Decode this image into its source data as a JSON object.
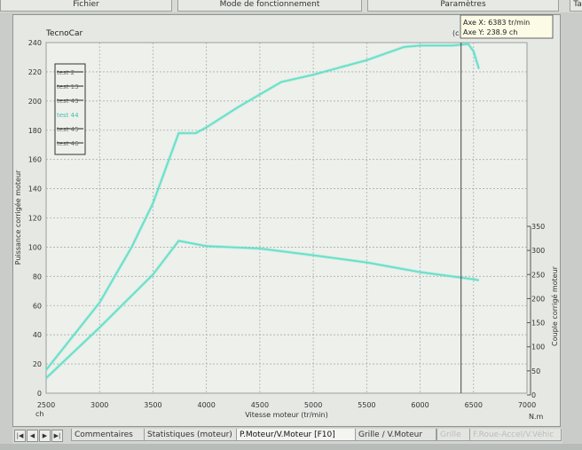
{
  "menu": {
    "fichier": "Fichier",
    "mode": "Mode de fonctionnement",
    "parametres": "Paramètres",
    "side": "Ta"
  },
  "chart": {
    "brand": "TecnoCar",
    "marker": "(c",
    "cursor_x": "Axe X: 6383 tr/min",
    "cursor_y": "Axe Y: 238.9 ch",
    "left_ylabel": "Puissance corrigée moteur",
    "right_ylabel": "Couple corrigé moteur",
    "xlabel": "Vitesse moteur (tr/min)",
    "left_unit": "ch",
    "right_unit": "N.m",
    "legend": [
      "test 2",
      "test 13",
      "test 43",
      "test 44",
      "test 45",
      "test 46"
    ]
  },
  "chart_data": {
    "type": "line",
    "xlabel": "Vitesse moteur (tr/min)",
    "ylabel": "Puissance corrigée moteur",
    "y2label": "Couple corrigé moteur",
    "xlim": [
      2500,
      7000
    ],
    "ylim": [
      0,
      240
    ],
    "y2lim": [
      0,
      350
    ],
    "x_ticks": [
      2500,
      3000,
      3500,
      4000,
      4500,
      5000,
      5500,
      6000,
      6500,
      7000
    ],
    "y_ticks": [
      0,
      20,
      40,
      60,
      80,
      100,
      120,
      140,
      160,
      180,
      200,
      220,
      240
    ],
    "y2_ticks": [
      0,
      50,
      100,
      150,
      200,
      250,
      300,
      350
    ],
    "grid": true,
    "legend_position": "top-left",
    "line_color": "#5fe0c8",
    "cursor_line_x": 6383,
    "series": [
      {
        "name": "Puissance corrigée moteur",
        "axis": "left",
        "x": [
          2500,
          3000,
          3300,
          3500,
          3740,
          3900,
          4000,
          4300,
          4700,
          5000,
          5500,
          5850,
          6000,
          6300,
          6450,
          6500,
          6550
        ],
        "y": [
          16,
          62,
          100,
          130,
          178,
          178,
          182,
          196,
          213,
          218,
          228,
          237,
          238,
          238,
          239,
          234,
          222
        ]
      },
      {
        "name": "Couple corrigé moteur",
        "axis": "right",
        "x": [
          2500,
          3000,
          3500,
          3740,
          4000,
          4500,
          5000,
          5500,
          6000,
          6500,
          6550
        ],
        "y": [
          35,
          140,
          250,
          320,
          309,
          304,
          290,
          275,
          255,
          240,
          238
        ]
      }
    ]
  },
  "tabs": {
    "commentaires": "Commentaires",
    "statistiques": "Statistiques (moteur)",
    "pmoteur": "P.Moteur/V.Moteur [F10]",
    "grille_v": "Grille / V.Moteur",
    "grille": "Grille",
    "froue": "F.Roue-Accel/V.Véhic"
  }
}
